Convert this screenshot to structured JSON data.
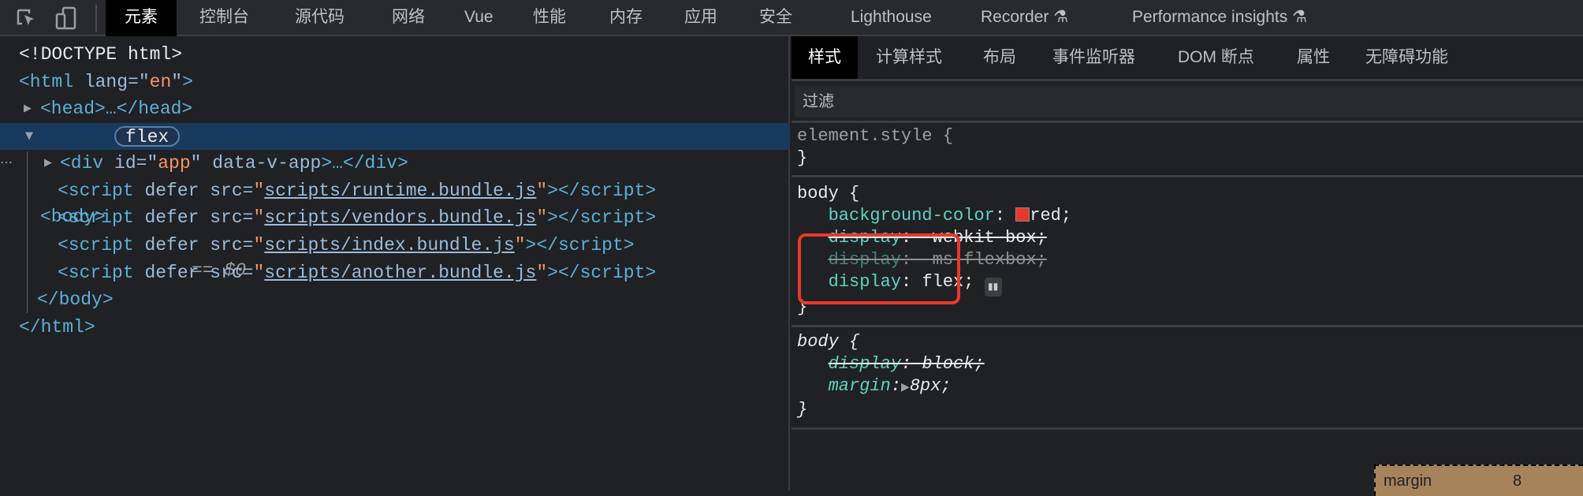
{
  "toolbar": {
    "icons": [
      "inspect-element-icon",
      "device-toolbar-icon"
    ],
    "tabs": [
      "元素",
      "控制台",
      "源代码",
      "网络",
      "Vue",
      "性能",
      "内存",
      "应用",
      "安全",
      "Lighthouse",
      "Recorder",
      "Performance insights"
    ],
    "active_tab": "元素"
  },
  "dom": {
    "doctype": "<!DOCTYPE html>",
    "html_open_tag": "<html",
    "html_lang_attr": "lang",
    "html_lang_value": "en",
    "head": "<head>…</head>",
    "body_tag": "<body>",
    "body_badge": "flex",
    "body_ref": "== $0",
    "div_tag": "<div",
    "div_id_attr": "id",
    "div_id_value": "app",
    "div_extra_attr": "data-v-app",
    "div_close": ">…</div>",
    "scripts": [
      "scripts/runtime.bundle.js",
      "scripts/vendors.bundle.js",
      "scripts/index.bundle.js",
      "scripts/another.bundle.js"
    ],
    "script_open": "<script",
    "script_attrs": "defer src=",
    "script_close": "></script>",
    "body_close": "</body>",
    "html_close": "</html>"
  },
  "styles": {
    "tabs": [
      "样式",
      "计算样式",
      "布局",
      "事件监听器",
      "DOM 断点",
      "属性",
      "无障碍功能"
    ],
    "active_tab": "样式",
    "filter_placeholder": "过滤",
    "element_style": "element.style {",
    "close_brace": "}",
    "rule1": {
      "selector": "body {",
      "props": [
        {
          "name": "background-color",
          "value": "red",
          "swatch": "#e8392c"
        },
        {
          "name": "display",
          "value": "-webkit-box",
          "overridden": true
        },
        {
          "name": "display",
          "value": "-ms-flexbox",
          "overridden": true,
          "invalid": true
        },
        {
          "name": "display",
          "value": "flex",
          "editor_icon": "flexbox-editor-icon"
        }
      ]
    },
    "rule2": {
      "selector": "body {",
      "props": [
        {
          "name": "display",
          "value": "block",
          "overridden": true
        },
        {
          "name": "margin",
          "value": "8px"
        }
      ]
    },
    "box_model": {
      "label": "margin",
      "value": "8"
    }
  },
  "colors": {
    "highlight_box": "#e8392c",
    "selected_row": "#173a5e"
  }
}
